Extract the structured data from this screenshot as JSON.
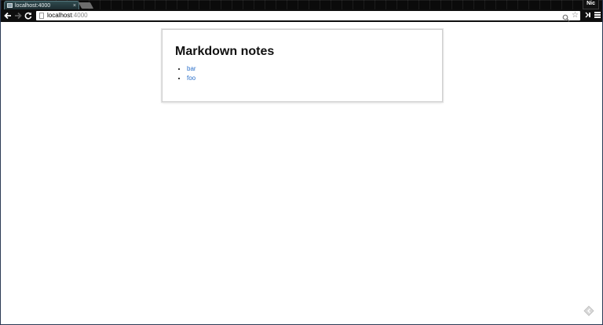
{
  "browser": {
    "tab": {
      "title": "localhost:4000",
      "close_label": "×"
    },
    "profile_name": "Nic",
    "address_bar": {
      "host": "localhost",
      "port": ":4000"
    },
    "icons": {
      "back": "back-arrow-icon",
      "forward": "forward-arrow-icon",
      "reload": "reload-icon",
      "zoom": "magnifier-icon",
      "bookmark": "star-icon",
      "extension": "extension-icon",
      "menu": "hamburger-menu-icon"
    }
  },
  "page": {
    "title": "Markdown notes",
    "notes": [
      {
        "label": "bar"
      },
      {
        "label": "foo"
      }
    ],
    "link_color": "#2a6fc9"
  }
}
